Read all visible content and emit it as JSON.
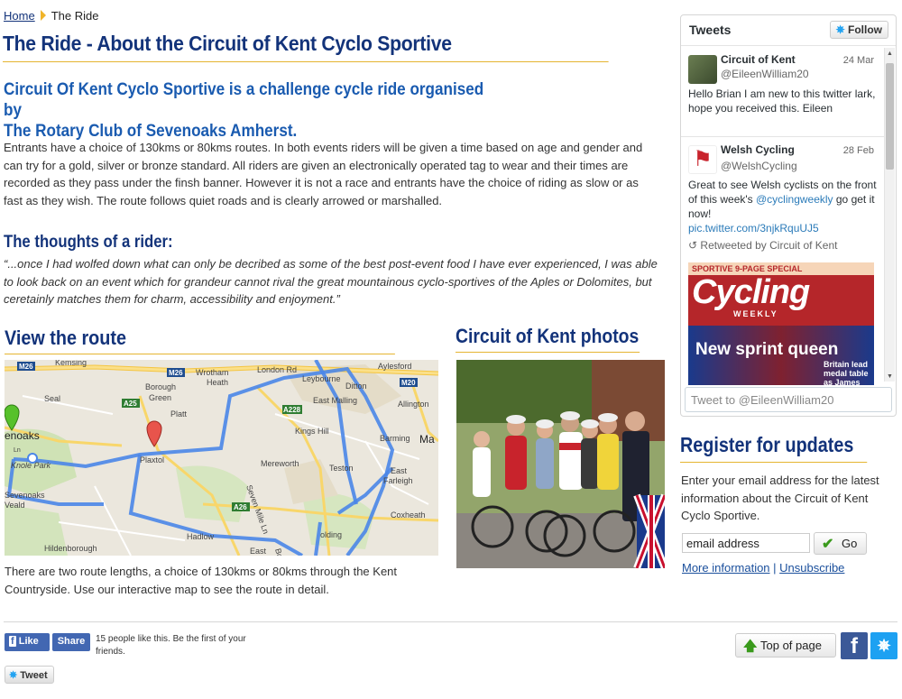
{
  "breadcrumb": {
    "home": "Home",
    "current": "The Ride"
  },
  "page_title": "The Ride - About the Circuit of Kent Cyclo Sportive",
  "intro_heading": "Circuit Of Kent Cyclo Sportive is a challenge cycle ride organised by The Rotary Club of Sevenoaks Amherst.",
  "intro_heading_line1": "Circuit Of Kent Cyclo Sportive is a challenge cycle ride organised by",
  "intro_heading_line2": "The Rotary Club of Sevenoaks Amherst.",
  "body_text": "Entrants have a choice of 130kms or 80kms routes. In both events riders will be given a time based on age and gender and can try for a gold, silver or bronze standard. All riders are given an electronically operated tag to wear and their times are recorded as they pass under the finsh banner. However it is not a race and entrants have the choice of riding as slow or as fast as they wish. The route follows quiet roads and is clearly arrowed or marshalled.",
  "thoughts_heading": "The thoughts of a rider:",
  "quote": "“...once I had wolfed down what can only be decribed as some of the best post-event food I have ever experienced, I was able to look back on an event which for grandeur cannot rival the great mountainous cyclo-sportives of the Aples or Dolomites, but ceretainly matches them for charm, accessibility and enjoyment.”",
  "route": {
    "heading": "View the route",
    "text": "There are two route lengths, a choice of 130kms or 80kms through the Kent Countryside. Use our interactive map to see the route in detail.",
    "map_labels": {
      "kemsing": "Kemsing",
      "m26a": "M26",
      "m26b": "M26",
      "wrotham": "Wrotham",
      "heath": "Heath",
      "london_rd": "London Rd",
      "aylesford": "Aylesford",
      "m20": "M20",
      "borough": "Borough",
      "green": "Green",
      "leybourne": "Leybourne",
      "ditton": "Ditton",
      "seal": "Seal",
      "platt": "Platt",
      "east_malling": "East Malling",
      "allington": "Allington",
      "a25": "A25",
      "a228": "A228",
      "sevenoaks": "enoaks",
      "ln": "Ln",
      "kings_hill": "Kings Hill",
      "barming": "Barming",
      "ma": "Ma",
      "plaxtol": "Plaxtol",
      "knole_park": "Knole Park",
      "mereworth": "Mereworth",
      "teston": "Teston",
      "east": "East",
      "farleigh": "Farleigh",
      "sevenoaks_lower": "Sevenoaks",
      "weald": "Veald",
      "seven_mile": "Seven Mile Ln",
      "a26": "A26",
      "coxheath": "Coxheath",
      "hildenborough": "Hildenborough",
      "hadlow": "Hadlow",
      "east2": "East",
      "golding": "olding",
      "boyle": "Boyle"
    }
  },
  "photos": {
    "heading": "Circuit of Kent photos"
  },
  "tweets": {
    "header": "Tweets",
    "follow": "Follow",
    "items": [
      {
        "name": "Circuit of Kent",
        "handle": "@EileenWilliam20",
        "date": "24 Mar",
        "text": "Hello Brian   I am new to this twitter lark, hope you received this.  Eileen"
      },
      {
        "name": "Welsh Cycling",
        "handle": "@WelshCycling",
        "date": "28 Feb",
        "text_pre": "Great to see Welsh cyclists on the front of this week's ",
        "mention": "@cyclingweekly",
        "text_post": " go get it now!",
        "link": "pic.twitter.com/3njkRquUJ5",
        "retweet": "Retweeted by Circuit of Kent"
      }
    ],
    "magazine": {
      "banner": "SPORTIVE 9-PAGE SPECIAL",
      "title": "Cycling",
      "subtitle": "WEEKLY",
      "headline": "New sprint queen",
      "side1": "Britain lead",
      "side2": "medal table",
      "side3": "as James"
    },
    "compose_placeholder": "Tweet to @EileenWilliam20"
  },
  "register": {
    "heading": "Register for updates",
    "text": "Enter your email address for the latest information about the Circuit of Kent Cyclo Sportive.",
    "email_value": "email address",
    "go": "Go",
    "more_info": "More information",
    "sep": " | ",
    "unsubscribe": "Unsubscribe"
  },
  "footer": {
    "like": "Like",
    "share": "Share",
    "like_text": "15 people like this. Be the first of your friends.",
    "tweet": "Tweet",
    "top_of_page": "Top of page"
  },
  "colors": {
    "navy": "#13337a",
    "blue": "#1a5bb0",
    "gold": "#e5b531",
    "facebook": "#3b5998",
    "twitter": "#1da1f2"
  }
}
